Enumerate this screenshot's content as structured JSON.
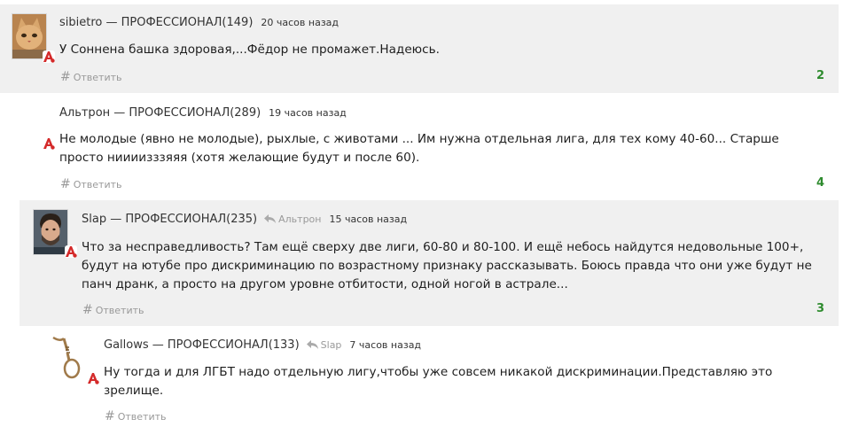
{
  "reply_label": "Ответить",
  "comments": [
    {
      "author": "sibietro — ПРОФЕССИОНАЛ(149)",
      "time": "20 часов назад",
      "reply_to": "",
      "text": "У Соннена башка здоровая,...Фёдор не промажет.Надеюсь.",
      "rating": "2",
      "avatar_icon": "cat-avatar"
    },
    {
      "author": "Альтрон — ПРОФЕССИОНАЛ(289)",
      "time": "19 часов назад",
      "reply_to": "",
      "text": "Не молодые (явно не молодые), рыхлые, с животами ... Им нужна отдельная лига, для тех кому 40-60... Старше просто ниииизззяяя (хотя желающие будут и после 60).",
      "rating": "4",
      "avatar_icon": ""
    },
    {
      "author": "Slap — ПРОФЕССИОНАЛ(235)",
      "time": "15 часов назад",
      "reply_to": "Альтрон",
      "text": "Что за несправедливость? Там ещё сверху две лиги, 60-80 и 80-100. И ещё небось найдутся недовольные 100+, будут на ютубе про дискриминацию по возрастному признаку рассказывать. Боюсь правда что они уже будут не панч дранк, а просто на другом уровне отбитости, одной ногой в астрале...",
      "rating": "3",
      "avatar_icon": "man-avatar"
    },
    {
      "author": "Gallows — ПРОФЕССИОНАЛ(133)",
      "time": "7 часов назад",
      "reply_to": "Slap",
      "text": "Ну тогда и для ЛГБТ надо отдельную лигу,чтобы уже совсем никакой дискриминации.Представляю это зрелище.",
      "rating": "",
      "avatar_icon": "noose-avatar"
    }
  ],
  "colors": {
    "shade": "#f0f0f0",
    "rating": "#2e8b2e",
    "badge_red": "#d42a2a"
  }
}
